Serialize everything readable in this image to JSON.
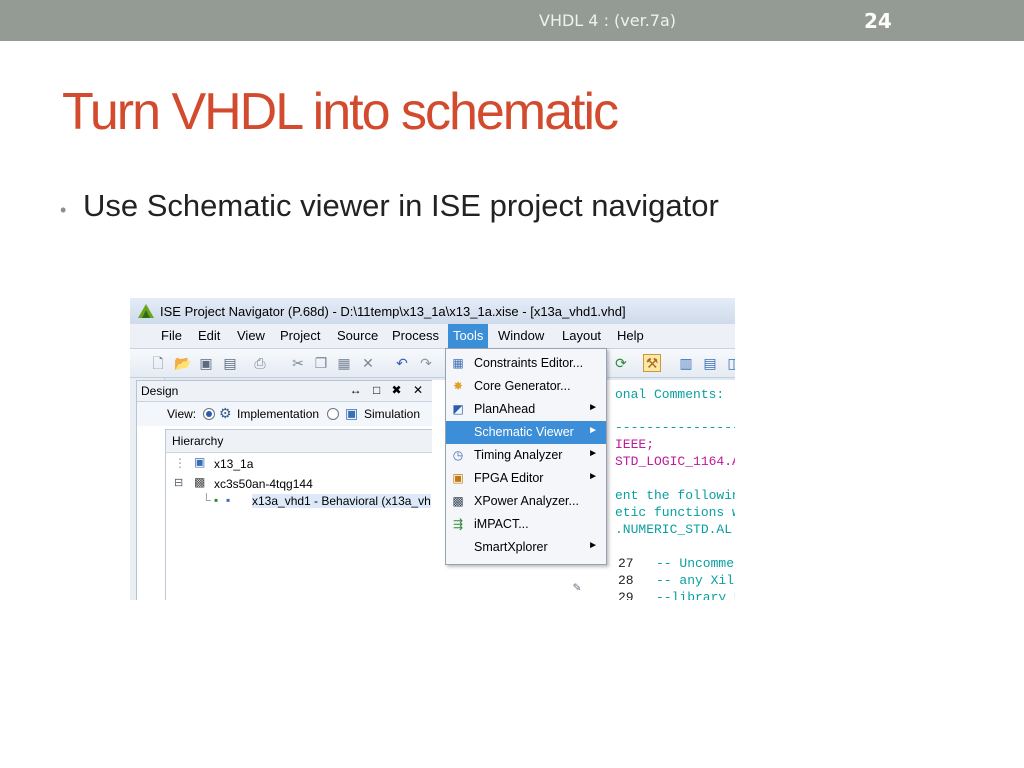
{
  "slide": {
    "header": "VHDL 4 : (ver.7a)",
    "page_number": "24",
    "title": "Turn VHDL into schematic",
    "bullet": "Use Schematic viewer in ISE project navigator"
  },
  "window": {
    "title": "ISE Project Navigator (P.68d) - D:\\11temp\\x13_1a\\x13_1a.xise - [x13a_vhd1.vhd]"
  },
  "menubar": {
    "items": [
      "File",
      "Edit",
      "View",
      "Project",
      "Source",
      "Process",
      "Tools",
      "Window",
      "Layout",
      "Help"
    ]
  },
  "design_panel": {
    "title": "Design",
    "controls": "↔ □ ✖ ✕",
    "view_label": "View:",
    "implementation_label": "Implementation",
    "simulation_label": "Simulation",
    "hierarchy_label": "Hierarchy",
    "tree": [
      "x13_1a",
      "xc3s50an-4tqg144",
      "x13a_vhd1 - Behavioral (x13a_vh"
    ]
  },
  "tools_menu": {
    "items": [
      {
        "label": "Constraints Editor...",
        "submenu": false
      },
      {
        "label": "Core Generator...",
        "submenu": false
      },
      {
        "label": "PlanAhead",
        "submenu": true
      },
      {
        "label": "Schematic Viewer",
        "submenu": true
      },
      {
        "label": "Timing Analyzer",
        "submenu": true
      },
      {
        "label": "FPGA Editor",
        "submenu": true
      },
      {
        "label": "XPower Analyzer...",
        "submenu": false
      },
      {
        "label": "iMPACT...",
        "submenu": false
      },
      {
        "label": "SmartXplorer",
        "submenu": true
      }
    ],
    "submenu_arrow": "►"
  },
  "code": {
    "lines": [
      {
        "text": "onal Comments:",
        "color": "#0aa0a0"
      },
      {
        "text": "----------------",
        "color": "#0aa0a0"
      },
      {
        "text": "IEEE;",
        "color": "#c0199a"
      },
      {
        "text": "STD_LOGIC_1164.A",
        "color": "#c0199a"
      },
      {
        "text": "ent the followin",
        "color": "#0aa0a0"
      },
      {
        "text": "etic functions w",
        "color": "#0aa0a0"
      },
      {
        "text": ".NUMERIC_STD.AL",
        "color": "#0aa0a0"
      },
      {
        "text": "-- Uncomment the followin",
        "color": "#0aa0a0"
      },
      {
        "text": "-- any Xilinx primitives",
        "color": "#0aa0a0"
      },
      {
        "text": "--library UNISIM;",
        "color": "#0aa0a0"
      }
    ],
    "line_numbers": [
      "27",
      "28",
      "29"
    ]
  }
}
